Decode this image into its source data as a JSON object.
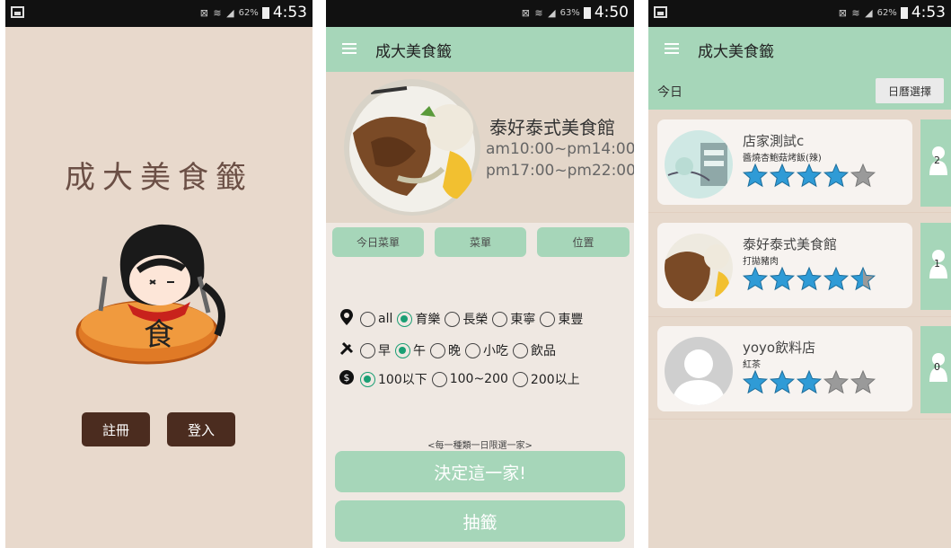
{
  "status_bars": [
    {
      "icons": "⊠ ≋ ◢",
      "battery": "62%",
      "time": "4:53"
    },
    {
      "icons": "⊠ ≋ ◢",
      "battery": "63%",
      "time": "4:50"
    },
    {
      "icons": "⊠ ≋ ◢",
      "battery": "62%",
      "time": "4:53"
    }
  ],
  "splash": {
    "title": "成大美食籤",
    "register_label": "註冊",
    "login_label": "登入"
  },
  "detail": {
    "toolbar_title": "成大美食籤",
    "restaurant_name": "泰好泰式美食館",
    "hours_1": "am10:00~pm14:00",
    "hours_2": "pm17:00~pm22:00",
    "tabs": [
      "今日菜單",
      "菜單",
      "位置"
    ],
    "filters": {
      "area": {
        "icon": "location-pin-icon",
        "options": [
          "all",
          "育樂",
          "長榮",
          "東寧",
          "東豐"
        ],
        "selected": 1
      },
      "meal": {
        "icon": "utensils-icon",
        "options": [
          "早",
          "午",
          "晚",
          "小吃",
          "飲品"
        ],
        "selected": 1
      },
      "price": {
        "icon": "dollar-icon",
        "options": [
          "100以下",
          "100~200",
          "200以上"
        ],
        "selected": 0
      }
    },
    "limit_note": "<每一種類一日限選一家>",
    "decide_label": "決定這一家!",
    "draw_label": "抽籤"
  },
  "history": {
    "toolbar_title": "成大美食籤",
    "today_label": "今日",
    "calendar_label": "日曆選擇",
    "cards": [
      {
        "name": "店家測試c",
        "dish": "醬燒杏鮑菇烤飯(辣)",
        "rating": 4,
        "count": "2"
      },
      {
        "name": "泰好泰式美食館",
        "dish": "打拋豬肉",
        "rating": 4.5,
        "count": "1"
      },
      {
        "name": "yoyo飲料店",
        "dish": "紅茶",
        "rating": 3,
        "count": "0"
      }
    ]
  },
  "colors": {
    "accent": "#a6d6b9",
    "brand_dark": "#4b2c1f",
    "radio": "#1a9f74",
    "star": "#2f9bd6"
  }
}
